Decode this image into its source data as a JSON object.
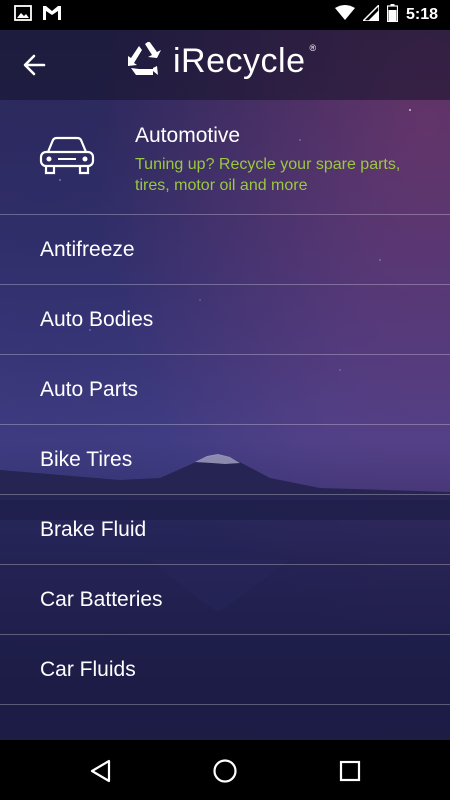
{
  "status_bar": {
    "time": "5:18",
    "icons": [
      "image-icon",
      "gmail-icon",
      "wifi-icon",
      "signal-icon",
      "battery-icon"
    ]
  },
  "app_bar": {
    "title": "iRecycle",
    "registered_mark": "®",
    "back_icon": "arrow-left-icon",
    "logo_icon": "recycle-icon"
  },
  "category": {
    "icon": "car-icon",
    "title": "Automotive",
    "description": "Tuning up? Recycle your spare parts, tires, motor oil and more",
    "description_color": "#9bc83f"
  },
  "items": [
    {
      "label": "Antifreeze"
    },
    {
      "label": "Auto Bodies"
    },
    {
      "label": "Auto Parts"
    },
    {
      "label": "Bike Tires"
    },
    {
      "label": "Brake Fluid"
    },
    {
      "label": "Car Batteries"
    },
    {
      "label": "Car Fluids"
    }
  ],
  "nav_bar": {
    "icons": [
      "back-triangle-icon",
      "home-circle-icon",
      "recents-square-icon"
    ]
  }
}
